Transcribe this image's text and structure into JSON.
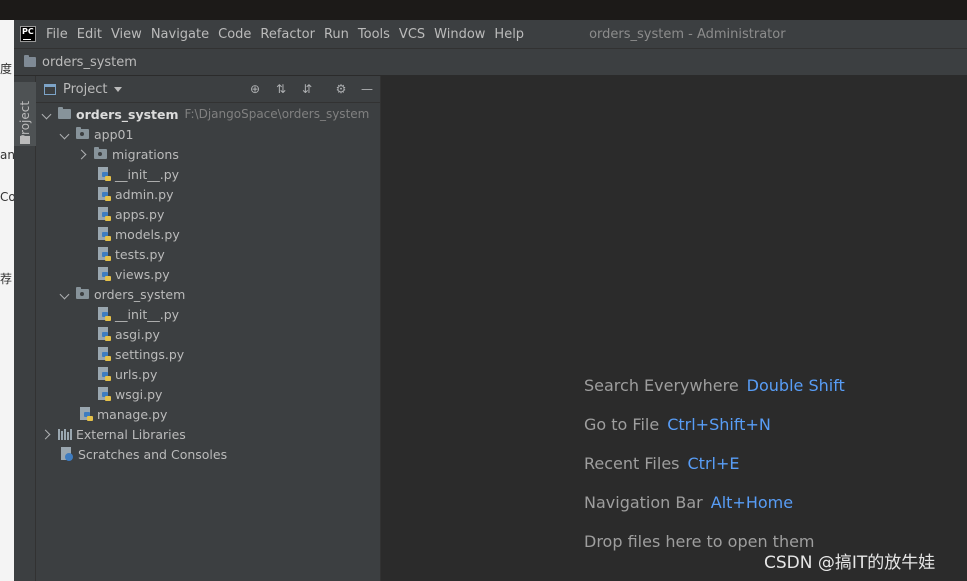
{
  "background": {
    "left_fragments": [
      "度",
      "an",
      "Co",
      "荐"
    ]
  },
  "menubar": {
    "app_logo_text": "PC",
    "items": [
      "File",
      "Edit",
      "View",
      "Navigate",
      "Code",
      "Refactor",
      "Run",
      "Tools",
      "VCS",
      "Window",
      "Help"
    ],
    "window_title": "orders_system - Administrator"
  },
  "navbar": {
    "label": "orders_system"
  },
  "tool_stripe": {
    "project_label": "Project"
  },
  "project_panel": {
    "title": "Project",
    "tree": [
      {
        "label": "orders_system",
        "path": "F:\\DjangoSpace\\orders_system"
      },
      {
        "label": "app01"
      },
      {
        "label": "migrations"
      },
      {
        "label": "__init__.py"
      },
      {
        "label": "admin.py"
      },
      {
        "label": "apps.py"
      },
      {
        "label": "models.py"
      },
      {
        "label": "tests.py"
      },
      {
        "label": "views.py"
      },
      {
        "label": "orders_system"
      },
      {
        "label": "__init__.py"
      },
      {
        "label": "asgi.py"
      },
      {
        "label": "settings.py"
      },
      {
        "label": "urls.py"
      },
      {
        "label": "wsgi.py"
      },
      {
        "label": "manage.py"
      },
      {
        "label": "External Libraries"
      },
      {
        "label": "Scratches and Consoles"
      }
    ]
  },
  "editor": {
    "hints": [
      {
        "text": "Search Everywhere",
        "key": "Double Shift"
      },
      {
        "text": "Go to File",
        "key": "Ctrl+Shift+N"
      },
      {
        "text": "Recent Files",
        "key": "Ctrl+E"
      },
      {
        "text": "Navigation Bar",
        "key": "Alt+Home"
      },
      {
        "text": "Drop files here to open them",
        "key": ""
      }
    ]
  },
  "watermark": "CSDN @搞IT的放牛娃",
  "colors": {
    "background": "#2b2b2b",
    "panel": "#3c3f41",
    "text": "#bbbbbb",
    "shortcut": "#589df6"
  }
}
